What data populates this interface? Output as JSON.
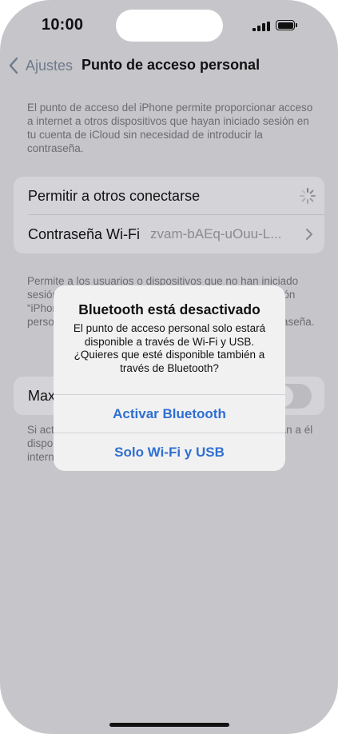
{
  "status_bar": {
    "time": "10:00",
    "signal_icon": "cellular-signal-icon",
    "battery_icon": "battery-icon"
  },
  "nav": {
    "back_label": "Ajustes",
    "title": "Punto de acceso personal"
  },
  "main": {
    "description": "El punto de acceso del iPhone permite proporcionar acceso a internet a otros dispositivos que hayan iniciado sesión en tu cuenta de iCloud sin necesidad de introducir la contraseña.",
    "rows": [
      {
        "label": "Permitir a otros conectarse",
        "accessory": "spinner-icon"
      },
      {
        "label": "Contraseña Wi-Fi",
        "value": "zvam-bAEq-uOuu-L...",
        "accessory": "chevron-right-icon"
      }
    ],
    "description2": "Permite a los usuarios o dispositivos que no han iniciado sesión en iCloud buscar tu red compartida en la sección “iPhone” de Ajustes > Wi-Fi con esta contraseña. Una persona con acceso a esta red puede usarla de contraseña.",
    "row_max_label": "Maximizar compatibilidad",
    "toggle_state": "off",
    "description3": "Si activas esta opción, los dispositivos que se conectan a él disponen de un rendimiento menor para la conexión a internet."
  },
  "alert": {
    "title": "Bluetooth está desactivado",
    "message": "El punto de acceso personal solo estará disponible a través de Wi-Fi y USB. ¿Quieres que esté disponible también a través de Bluetooth?",
    "buttons": [
      "Activar Bluetooth",
      "Solo Wi-Fi y USB"
    ]
  },
  "colors": {
    "accent": "#2f6fd1",
    "dim_background": "#c6c5ca"
  }
}
